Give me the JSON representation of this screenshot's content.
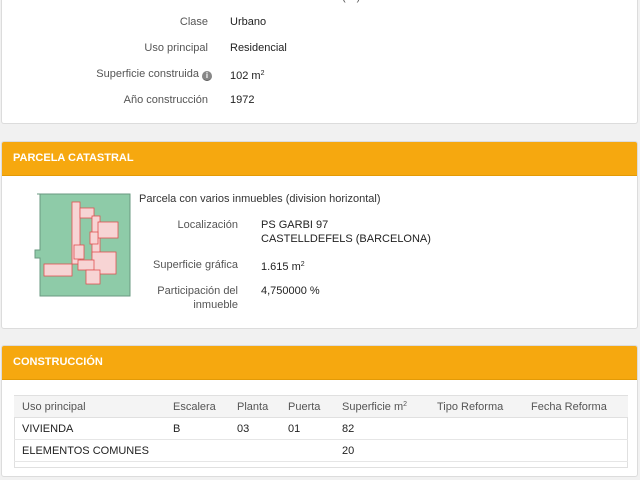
{
  "inmueble": {
    "rows": [
      {
        "label": "Clase",
        "value": "Urbano"
      },
      {
        "label": "Uso principal",
        "value": "Residencial"
      },
      {
        "label": "Superficie construida",
        "value": "102 m"
      },
      {
        "label": "Año construcción",
        "value": "1972"
      }
    ],
    "top_partial_text": "(…)",
    "sup2": "2",
    "info_icon": "i"
  },
  "parcela": {
    "header": "PARCELA CATASTRAL",
    "description": "Parcela con varios inmuebles (division horizontal)",
    "localizacion_label": "Localización",
    "localizacion_line1": "PS GARBI 97",
    "localizacion_line2": "CASTELLDEFELS (BARCELONA)",
    "superficie_label": "Superficie gráfica",
    "superficie_value": "1.615 m",
    "participacion_label_1": "Participación del",
    "participacion_label_2": "inmueble",
    "participacion_value": "4,750000 %",
    "plan_icon": "parcel-plan"
  },
  "construccion": {
    "header": "CONSTRUCCIÓN",
    "columns": [
      "Uso principal",
      "Escalera",
      "Planta",
      "Puerta",
      "Superficie m",
      "Tipo Reforma",
      "Fecha Reforma"
    ],
    "rows": [
      [
        "VIVIENDA",
        "B",
        "03",
        "01",
        "82",
        "",
        ""
      ],
      [
        "ELEMENTOS COMUNES",
        "",
        "",
        "",
        "20",
        "",
        ""
      ]
    ]
  },
  "colors": {
    "header_bg": "#f6a80f",
    "parcel_fill": "#8ecba8",
    "building_outline": "#e05050"
  }
}
